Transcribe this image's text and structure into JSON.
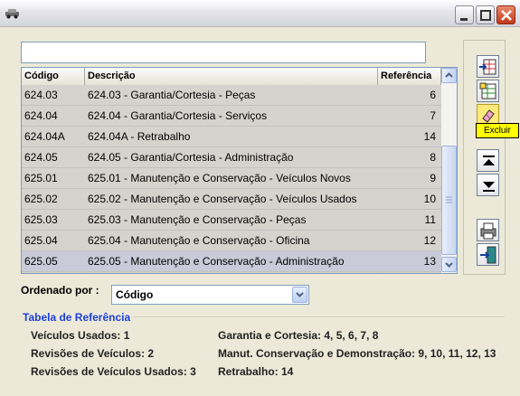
{
  "window": {
    "title": "",
    "buttons": [
      "minimize",
      "maximize",
      "close"
    ]
  },
  "search": {
    "value": "",
    "placeholder": ""
  },
  "grid": {
    "columns": [
      "Código",
      "Descrição",
      "Referência"
    ],
    "rows": [
      {
        "codigo": "624.03",
        "descricao": "624.03 - Garantia/Cortesia - Peças",
        "referencia": "6"
      },
      {
        "codigo": "624.04",
        "descricao": "624.04 - Garantia/Cortesia - Serviços",
        "referencia": "7"
      },
      {
        "codigo": "624.04A",
        "descricao": "624.04A - Retrabalho",
        "referencia": "14"
      },
      {
        "codigo": "624.05",
        "descricao": "624.05 - Garantia/Cortesia - Administração",
        "referencia": "8"
      },
      {
        "codigo": "625.01",
        "descricao": "625.01 - Manutenção e Conservação - Veículos Novos",
        "referencia": "9"
      },
      {
        "codigo": "625.02",
        "descricao": "625.02 - Manutenção e Conservação - Veículos Usados",
        "referencia": "10"
      },
      {
        "codigo": "625.03",
        "descricao": "625.03 - Manutenção e Conservação - Peças",
        "referencia": "11"
      },
      {
        "codigo": "625.04",
        "descricao": "625.04 - Manutenção e Conservação - Oficina",
        "referencia": "12"
      },
      {
        "codigo": "625.05",
        "descricao": "625.05 - Manutenção e Conservação - Administração",
        "referencia": "13"
      }
    ],
    "selected_row": 8
  },
  "toolbar": {
    "buttons": [
      "insert-row-icon",
      "edit-grid-icon",
      "eraser-icon",
      "move-up-icon",
      "move-down-icon",
      "print-icon",
      "exit-door-icon"
    ],
    "tooltip": "Excluir"
  },
  "order": {
    "label": "Ordenado por :",
    "value": "Código"
  },
  "reference_panel": {
    "title": "Tabela de Referência",
    "items": {
      "novos": "Veículos Usados: 1",
      "revisoes": "Revisões de Veículos: 2",
      "revisoes_usados": "Revisões de Veículos Usados: 3",
      "garantia": "Garantia e Cortesia:  4, 5, 6, 7, 8",
      "manut": "Manut. Conservação e Demonstração: 9, 10, 11, 12, 13",
      "retrabalho": "Retrabalho: 14"
    }
  },
  "colors": {
    "accent": "#1c3fd8",
    "tooltip_bg": "#ffff00",
    "window_bg": "#ece9d8"
  }
}
